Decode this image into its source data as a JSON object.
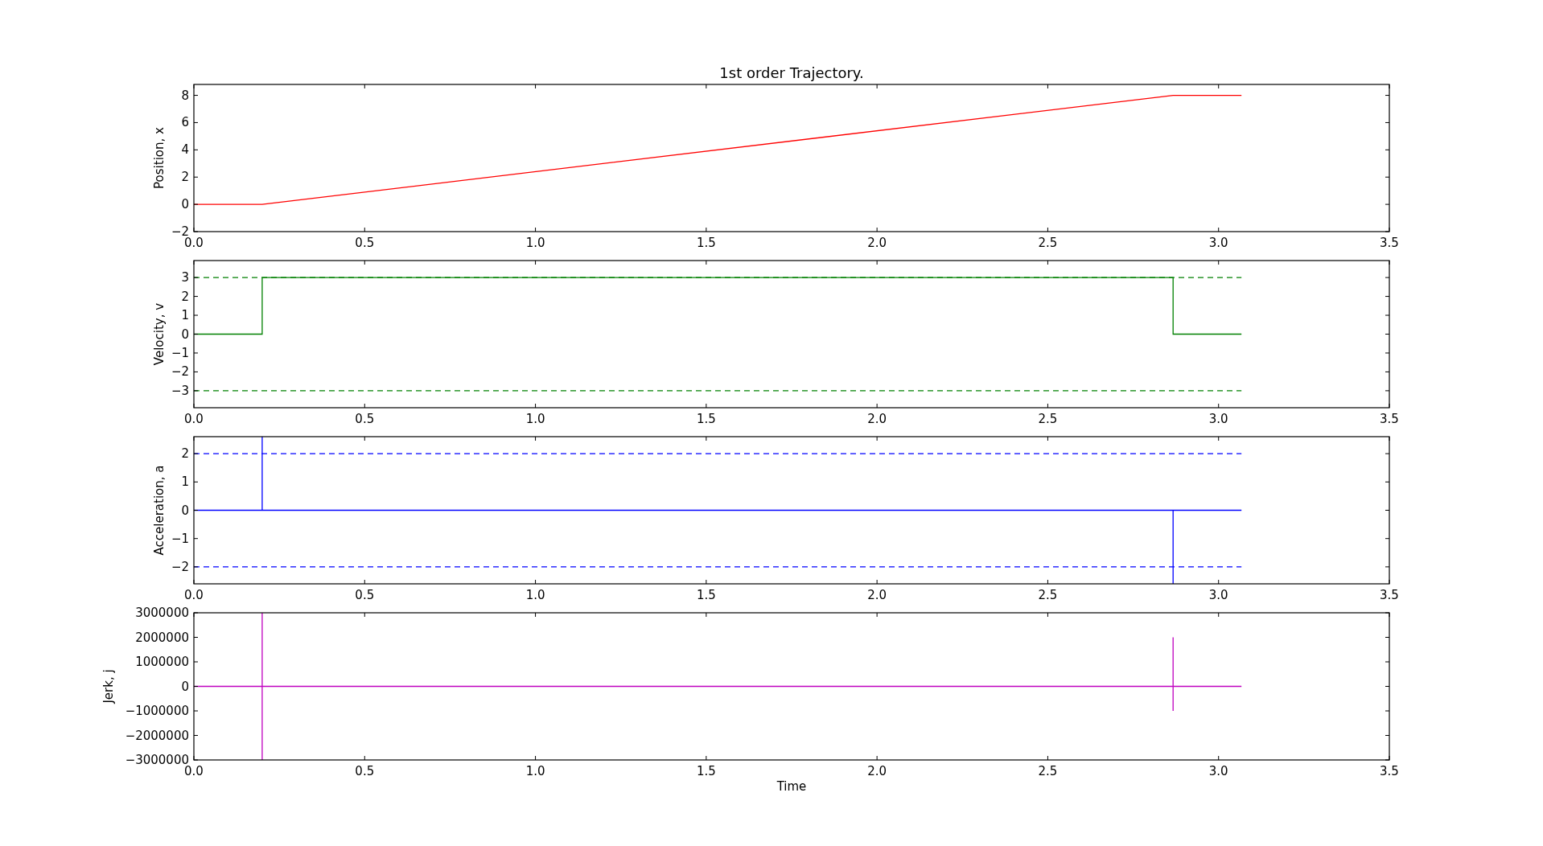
{
  "panels": [
    {
      "chart_data": {
        "type": "line",
        "title": "1st order Trajectory.",
        "ylabel": "Position, x",
        "x": [
          0,
          0.2,
          2.867,
          3.067
        ],
        "series": [
          {
            "color": "#ff0000",
            "line_style": "solid",
            "values": [
              0,
              0,
              8,
              8
            ]
          }
        ],
        "xlim": [
          0,
          3.5
        ],
        "ylim": [
          -2,
          8.8
        ],
        "xticks": [
          {
            "value": 0,
            "label": "0.0"
          },
          {
            "value": 0.5,
            "label": "0.5"
          },
          {
            "value": 1,
            "label": "1.0"
          },
          {
            "value": 1.5,
            "label": "1.5"
          },
          {
            "value": 2,
            "label": "2.0"
          },
          {
            "value": 2.5,
            "label": "2.5"
          },
          {
            "value": 3,
            "label": "3.0"
          },
          {
            "value": 3.5,
            "label": "3.5"
          }
        ],
        "yticks": [
          {
            "value": -2,
            "label": "−2"
          },
          {
            "value": 0,
            "label": "0"
          },
          {
            "value": 2,
            "label": "2"
          },
          {
            "value": 4,
            "label": "4"
          },
          {
            "value": 6,
            "label": "6"
          },
          {
            "value": 8,
            "label": "8"
          }
        ]
      }
    },
    {
      "chart_data": {
        "type": "line",
        "ylabel": "Velocity, v",
        "x": [
          0,
          0.2,
          0.2,
          2.867,
          2.867,
          3.067
        ],
        "series": [
          {
            "color": "#008000",
            "line_style": "solid",
            "values": [
              0,
              0,
              3,
              3,
              0,
              0
            ]
          },
          {
            "color": "#008000",
            "line_style": "dashed",
            "values": [
              3,
              3,
              3,
              3,
              3,
              3
            ]
          },
          {
            "color": "#008000",
            "line_style": "dashed",
            "values": [
              -3,
              -3,
              -3,
              -3,
              -3,
              -3
            ]
          }
        ],
        "xlim": [
          0,
          3.5
        ],
        "ylim": [
          -3.9,
          3.9
        ],
        "xticks": [
          {
            "value": 0,
            "label": "0.0"
          },
          {
            "value": 0.5,
            "label": "0.5"
          },
          {
            "value": 1,
            "label": "1.0"
          },
          {
            "value": 1.5,
            "label": "1.5"
          },
          {
            "value": 2,
            "label": "2.0"
          },
          {
            "value": 2.5,
            "label": "2.5"
          },
          {
            "value": 3,
            "label": "3.0"
          },
          {
            "value": 3.5,
            "label": "3.5"
          }
        ],
        "yticks": [
          {
            "value": -3,
            "label": "−3"
          },
          {
            "value": -2,
            "label": "−2"
          },
          {
            "value": -1,
            "label": "−1"
          },
          {
            "value": 0,
            "label": "0"
          },
          {
            "value": 1,
            "label": "1"
          },
          {
            "value": 2,
            "label": "2"
          },
          {
            "value": 3,
            "label": "3"
          }
        ]
      }
    },
    {
      "chart_data": {
        "type": "line",
        "ylabel": "Acceleration, a",
        "x": [
          0,
          0.2,
          0.2,
          0.2,
          2.867,
          2.867,
          2.867,
          3.067
        ],
        "series": [
          {
            "color": "#0000ff",
            "line_style": "solid",
            "values": [
              0,
              0,
              2.6,
              0,
              0,
              -2.6,
              0,
              0
            ]
          },
          {
            "color": "#0000ff",
            "line_style": "dashed",
            "values": [
              2,
              2,
              2,
              2,
              2,
              2,
              2,
              2
            ]
          },
          {
            "color": "#0000ff",
            "line_style": "dashed",
            "values": [
              -2,
              -2,
              -2,
              -2,
              -2,
              -2,
              -2,
              -2
            ]
          }
        ],
        "xlim": [
          0,
          3.5
        ],
        "ylim": [
          -2.6,
          2.6
        ],
        "xticks": [
          {
            "value": 0,
            "label": "0.0"
          },
          {
            "value": 0.5,
            "label": "0.5"
          },
          {
            "value": 1,
            "label": "1.0"
          },
          {
            "value": 1.5,
            "label": "1.5"
          },
          {
            "value": 2,
            "label": "2.0"
          },
          {
            "value": 2.5,
            "label": "2.5"
          },
          {
            "value": 3,
            "label": "3.0"
          },
          {
            "value": 3.5,
            "label": "3.5"
          }
        ],
        "yticks": [
          {
            "value": -2,
            "label": "−2"
          },
          {
            "value": -1,
            "label": "−1"
          },
          {
            "value": 0,
            "label": "0"
          },
          {
            "value": 1,
            "label": "1"
          },
          {
            "value": 2,
            "label": "2"
          }
        ]
      }
    },
    {
      "chart_data": {
        "type": "line",
        "xlabel": "Time",
        "ylabel": "Jerk, j",
        "x": [
          0,
          0.2,
          0.2,
          0.2,
          0.2,
          2.867,
          2.867,
          2.867,
          2.867,
          3.067
        ],
        "series": [
          {
            "color": "#bf00bf",
            "line_style": "solid",
            "values": [
              0,
              0,
              3000000,
              -3000000,
              0,
              0,
              2000000,
              -1000000,
              0,
              0
            ]
          }
        ],
        "xlim": [
          0,
          3.5
        ],
        "ylim": [
          -3000000,
          3000000
        ],
        "xticks": [
          {
            "value": 0,
            "label": "0.0"
          },
          {
            "value": 0.5,
            "label": "0.5"
          },
          {
            "value": 1,
            "label": "1.0"
          },
          {
            "value": 1.5,
            "label": "1.5"
          },
          {
            "value": 2,
            "label": "2.0"
          },
          {
            "value": 2.5,
            "label": "2.5"
          },
          {
            "value": 3,
            "label": "3.0"
          },
          {
            "value": 3.5,
            "label": "3.5"
          }
        ],
        "yticks": [
          {
            "value": -3000000,
            "label": "−3000000"
          },
          {
            "value": -2000000,
            "label": "−2000000"
          },
          {
            "value": -1000000,
            "label": "−1000000"
          },
          {
            "value": 0,
            "label": "0"
          },
          {
            "value": 1000000,
            "label": "1000000"
          },
          {
            "value": 2000000,
            "label": "2000000"
          },
          {
            "value": 3000000,
            "label": "3000000"
          }
        ]
      }
    }
  ]
}
